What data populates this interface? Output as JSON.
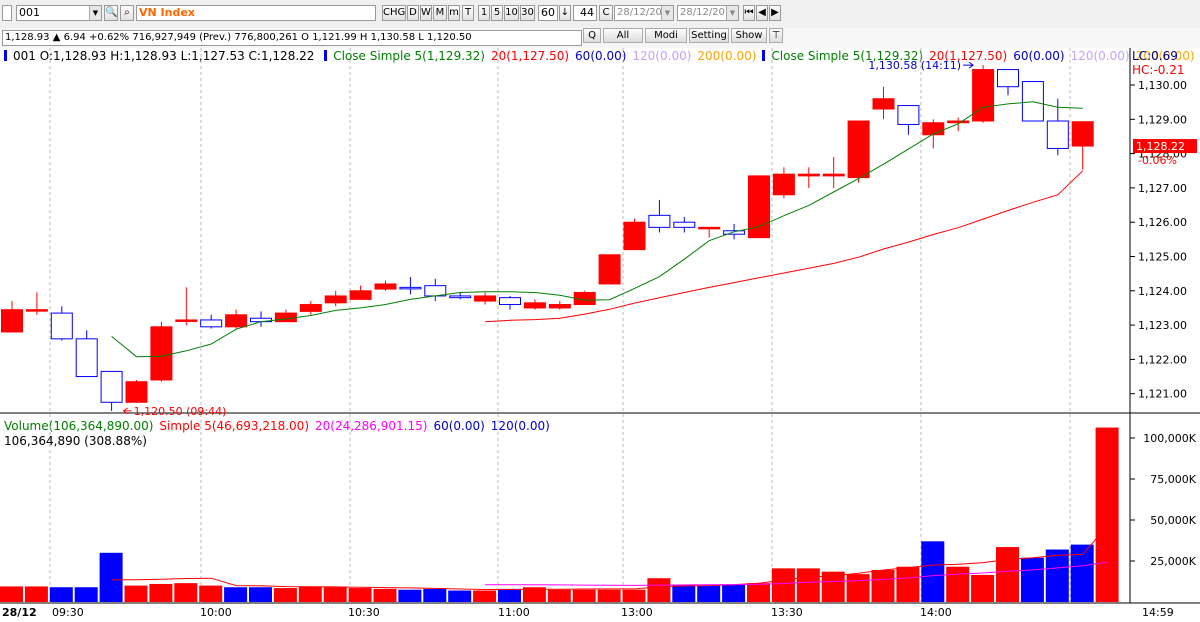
{
  "toolbar": {
    "symbol": "001",
    "index_name": "VN Index",
    "buttons": [
      "CHG",
      "D",
      "W",
      "M",
      "m",
      "T",
      "1",
      "5",
      "10",
      "30"
    ],
    "interval": "60",
    "count": "44",
    "c_button": "C",
    "date_from": "28/12/20…",
    "date_to": "28/12/20…"
  },
  "info_line": "1,128.93 ▲ 6.94 +0.62% 716,927,949 (Prev.) 776,800,261 O 1,121.99 H 1,130.58 L 1,120.50",
  "tabs": [
    "Q",
    "All",
    "Modi",
    "Setting",
    "Show"
  ],
  "price_legend": {
    "ohlc": "001 O:1,128.93 H:1,128.93 L:1,127.53 C:1,128.22",
    "ma_left": [
      {
        "text": "Close Simple 5(1,129.32)",
        "color": "#008000"
      },
      {
        "text": "20(1,127.50)",
        "color": "#ff0000"
      },
      {
        "text": "60(0.00)",
        "color": "#0000cc"
      },
      {
        "text": "120(0.00)",
        "color": "#c8a0ff"
      },
      {
        "text": "200(0.00)",
        "color": "#ffa500"
      }
    ],
    "ma_right": [
      {
        "text": "Close Simple 5(1,129.32)",
        "color": "#008000"
      },
      {
        "text": "20(1,127.50)",
        "color": "#ff0000"
      },
      {
        "text": "60(0.00)",
        "color": "#0000cc"
      },
      {
        "text": "120(0.00)",
        "color": "#c8a0ff"
      },
      {
        "text": "200(0.00)",
        "color": "#ffa500"
      }
    ],
    "lc": "LC:0.69",
    "hc": "HC:-0.21"
  },
  "volume_legend": {
    "items": [
      {
        "text": "Volume(106,364,890.00)",
        "color": "#008000"
      },
      {
        "text": "Simple 5(46,693,218.00)",
        "color": "#ff0000"
      },
      {
        "text": "20(24,286,901.15)",
        "color": "#ff00ff"
      },
      {
        "text": "60(0.00)",
        "color": "#0000cc"
      },
      {
        "text": "120(0.00)",
        "color": "#0000cc"
      }
    ],
    "current": "106,364,890 (308.88%)"
  },
  "colors": {
    "up": "#ff0000",
    "down": "#0000ff",
    "ma5": "#008000",
    "ma20": "#ff0000",
    "vol_ma20": "#ff00ff",
    "hollow": "#ffffff"
  },
  "chart_data": [
    {
      "type": "candlestick",
      "title": "VN Index",
      "ylim": [
        1120.5,
        1130.95
      ],
      "y_ticks": [
        1121,
        1122,
        1123,
        1124,
        1125,
        1126,
        1127,
        1128,
        1129,
        1130
      ],
      "y_tick_labels": [
        "1,121.00",
        "1,122.00",
        "1,123.00",
        "1,124.00",
        "1,125.00",
        "1,126.00",
        "1,127.00",
        "1,128.00",
        "1,129.00",
        "1,130.00"
      ],
      "x_labels": [
        "28/12",
        "09:30",
        "10:00",
        "10:30",
        "11:00",
        "13:00",
        "13:30",
        "14:00",
        "14:59"
      ],
      "grid": true,
      "candles": [
        {
          "o": 1122.8,
          "h": 1123.7,
          "l": 1122.8,
          "c": 1123.45,
          "up": true
        },
        {
          "o": 1123.45,
          "h": 1123.95,
          "l": 1123.3,
          "c": 1123.45,
          "up": true
        },
        {
          "o": 1123.35,
          "h": 1123.55,
          "l": 1122.55,
          "c": 1122.6,
          "up": false
        },
        {
          "o": 1122.6,
          "h": 1122.85,
          "l": 1121.5,
          "c": 1121.5,
          "up": false
        },
        {
          "o": 1121.65,
          "h": 1121.65,
          "l": 1120.5,
          "c": 1120.75,
          "up": false
        },
        {
          "o": 1120.75,
          "h": 1121.4,
          "l": 1120.75,
          "c": 1121.35,
          "up": true
        },
        {
          "o": 1121.4,
          "h": 1123.1,
          "l": 1121.35,
          "c": 1122.95,
          "up": true
        },
        {
          "o": 1123.15,
          "h": 1124.1,
          "l": 1123.0,
          "c": 1123.15,
          "up": true
        },
        {
          "o": 1123.15,
          "h": 1123.3,
          "l": 1122.9,
          "c": 1122.95,
          "up": false
        },
        {
          "o": 1122.95,
          "h": 1123.45,
          "l": 1122.9,
          "c": 1123.3,
          "up": true
        },
        {
          "o": 1123.2,
          "h": 1123.4,
          "l": 1122.95,
          "c": 1123.1,
          "up": false
        },
        {
          "o": 1123.1,
          "h": 1123.45,
          "l": 1123.1,
          "c": 1123.35,
          "up": true
        },
        {
          "o": 1123.4,
          "h": 1123.7,
          "l": 1123.3,
          "c": 1123.6,
          "up": true
        },
        {
          "o": 1123.65,
          "h": 1124.0,
          "l": 1123.55,
          "c": 1123.85,
          "up": true
        },
        {
          "o": 1123.75,
          "h": 1124.15,
          "l": 1123.75,
          "c": 1124.0,
          "up": true
        },
        {
          "o": 1124.05,
          "h": 1124.3,
          "l": 1124.0,
          "c": 1124.2,
          "up": true
        },
        {
          "o": 1124.1,
          "h": 1124.4,
          "l": 1123.9,
          "c": 1124.1,
          "up": false
        },
        {
          "o": 1124.15,
          "h": 1124.35,
          "l": 1123.7,
          "c": 1123.85,
          "up": false
        },
        {
          "o": 1123.85,
          "h": 1123.95,
          "l": 1123.75,
          "c": 1123.8,
          "up": false
        },
        {
          "o": 1123.7,
          "h": 1123.95,
          "l": 1123.6,
          "c": 1123.85,
          "up": true
        },
        {
          "o": 1123.8,
          "h": 1123.85,
          "l": 1123.45,
          "c": 1123.6,
          "up": false
        },
        {
          "o": 1123.5,
          "h": 1123.75,
          "l": 1123.45,
          "c": 1123.65,
          "up": true
        },
        {
          "o": 1123.5,
          "h": 1123.7,
          "l": 1123.45,
          "c": 1123.6,
          "up": true
        },
        {
          "o": 1123.6,
          "h": 1124.0,
          "l": 1123.6,
          "c": 1123.95,
          "up": true
        },
        {
          "o": 1124.2,
          "h": 1125.05,
          "l": 1124.2,
          "c": 1125.05,
          "up": true
        },
        {
          "o": 1125.2,
          "h": 1126.1,
          "l": 1125.2,
          "c": 1126.0,
          "up": true
        },
        {
          "o": 1126.2,
          "h": 1126.65,
          "l": 1125.7,
          "c": 1125.85,
          "up": false
        },
        {
          "o": 1126.0,
          "h": 1126.15,
          "l": 1125.7,
          "c": 1125.85,
          "up": false
        },
        {
          "o": 1125.85,
          "h": 1125.85,
          "l": 1125.55,
          "c": 1125.85,
          "up": true
        },
        {
          "o": 1125.75,
          "h": 1125.95,
          "l": 1125.5,
          "c": 1125.65,
          "up": false
        },
        {
          "o": 1125.55,
          "h": 1127.35,
          "l": 1125.55,
          "c": 1127.35,
          "up": true
        },
        {
          "o": 1126.8,
          "h": 1127.6,
          "l": 1126.7,
          "c": 1127.4,
          "up": true
        },
        {
          "o": 1127.35,
          "h": 1127.6,
          "l": 1127.0,
          "c": 1127.4,
          "up": true
        },
        {
          "o": 1127.35,
          "h": 1127.9,
          "l": 1127.0,
          "c": 1127.4,
          "up": true
        },
        {
          "o": 1127.3,
          "h": 1128.95,
          "l": 1127.15,
          "c": 1128.95,
          "up": true
        },
        {
          "o": 1129.3,
          "h": 1129.95,
          "l": 1129.0,
          "c": 1129.6,
          "up": true
        },
        {
          "o": 1129.4,
          "h": 1129.4,
          "l": 1128.55,
          "c": 1128.85,
          "up": false
        },
        {
          "o": 1128.55,
          "h": 1129.0,
          "l": 1128.15,
          "c": 1128.9,
          "up": true
        },
        {
          "o": 1128.9,
          "h": 1129.05,
          "l": 1128.65,
          "c": 1128.95,
          "up": true
        },
        {
          "o": 1128.95,
          "h": 1130.58,
          "l": 1128.9,
          "c": 1130.45,
          "up": true
        },
        {
          "o": 1130.45,
          "h": 1130.45,
          "l": 1129.7,
          "c": 1129.95,
          "up": false
        },
        {
          "o": 1130.1,
          "h": 1130.1,
          "l": 1128.95,
          "c": 1128.95,
          "up": false
        },
        {
          "o": 1128.95,
          "h": 1129.6,
          "l": 1127.95,
          "c": 1128.15,
          "up": false
        },
        {
          "o": 1128.93,
          "h": 1128.93,
          "l": 1127.53,
          "c": 1128.22,
          "up": true
        }
      ],
      "ma5": [
        null,
        null,
        null,
        null,
        1122.67,
        1122.08,
        1122.09,
        1122.25,
        1122.45,
        1122.88,
        1123.1,
        1123.18,
        1123.28,
        1123.43,
        1123.5,
        1123.6,
        1123.75,
        1123.85,
        1123.95,
        1123.97,
        1123.97,
        1123.95,
        1123.87,
        1123.73,
        1123.74,
        1124.07,
        1124.41,
        1124.92,
        1125.46,
        1125.72,
        1125.87,
        1126.19,
        1126.49,
        1126.88,
        1127.27,
        1127.69,
        1128.13,
        1128.57,
        1128.87,
        1129.35,
        1129.45,
        1129.51,
        1129.35,
        1129.32
      ],
      "ma20": [
        null,
        null,
        null,
        null,
        null,
        null,
        null,
        null,
        null,
        null,
        null,
        null,
        null,
        null,
        null,
        null,
        null,
        null,
        null,
        1123.1,
        1123.14,
        1123.16,
        1123.2,
        1123.32,
        1123.46,
        1123.64,
        1123.8,
        1123.95,
        1124.1,
        1124.24,
        1124.38,
        1124.52,
        1124.66,
        1124.8,
        1124.98,
        1125.22,
        1125.42,
        1125.64,
        1125.84,
        1126.09,
        1126.34,
        1126.58,
        1126.8,
        1127.5
      ],
      "annotations": [
        {
          "text": "1,120.50 (09:44)",
          "color": "#ff0000",
          "candle": 4,
          "price": 1120.5
        },
        {
          "text": "1,130.58 (14:11)",
          "color": "#0000cc",
          "candle": 39,
          "price": 1130.58
        }
      ],
      "last_price": "1,128.22",
      "last_change": "-0.06%"
    },
    {
      "type": "bar",
      "title": "Volume",
      "ylim": [
        0,
        107000
      ],
      "y_ticks": [
        25000,
        50000,
        75000,
        100000
      ],
      "y_tick_labels": [
        "25,000K",
        "50,000K",
        "75,000K",
        "100,000K"
      ],
      "unit": "K",
      "values": [
        9500,
        9500,
        9000,
        9000,
        30000,
        10000,
        11000,
        11500,
        10000,
        9000,
        9000,
        8500,
        9500,
        9000,
        8500,
        8000,
        7500,
        8000,
        7000,
        7000,
        8000,
        9000,
        7500,
        7500,
        7500,
        7500,
        14500,
        10500,
        10000,
        10500,
        11500,
        20500,
        20500,
        18500,
        17000,
        19500,
        21500,
        37000,
        21500,
        16500,
        33500,
        27000,
        32000,
        35000,
        106365
      ],
      "colors_up": [
        true,
        true,
        false,
        false,
        false,
        true,
        true,
        true,
        true,
        false,
        false,
        true,
        true,
        true,
        true,
        true,
        false,
        false,
        false,
        true,
        false,
        true,
        true,
        true,
        true,
        true,
        true,
        false,
        false,
        false,
        true,
        true,
        true,
        true,
        true,
        true,
        true,
        false,
        true,
        true,
        true,
        false,
        false,
        false,
        true
      ],
      "ma5_line": [
        null,
        null,
        null,
        null,
        13500,
        13600,
        13900,
        14300,
        14500,
        10000,
        9900,
        9400,
        9300,
        9200,
        9000,
        8800,
        8600,
        8300,
        7900,
        7600,
        7600,
        7800,
        7800,
        7900,
        8000,
        8000,
        9300,
        9800,
        10000,
        10600,
        11400,
        13500,
        15000,
        16000,
        17500,
        19500,
        21000,
        22500,
        23000,
        24000,
        26000,
        27000,
        28500,
        29000,
        46693
      ],
      "ma20_line": [
        null,
        null,
        null,
        null,
        null,
        null,
        null,
        null,
        null,
        null,
        null,
        null,
        null,
        null,
        null,
        null,
        null,
        null,
        null,
        10500,
        10500,
        10500,
        10400,
        10300,
        10200,
        10100,
        10300,
        10400,
        10500,
        10600,
        10800,
        11300,
        12000,
        12500,
        13000,
        13800,
        14700,
        16100,
        17000,
        17700,
        18700,
        19600,
        20800,
        22100,
        24287
      ]
    }
  ]
}
